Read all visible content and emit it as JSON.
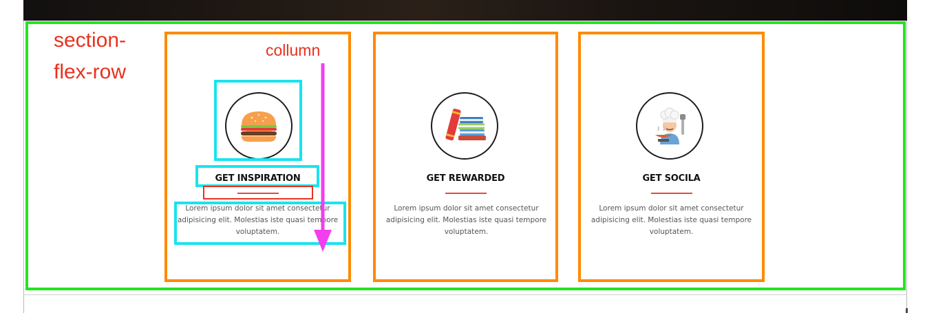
{
  "annotations": {
    "section_label": "section-flex-row",
    "column_label": "collumn",
    "colors": {
      "section_outline": "#22e51f",
      "column_outline": "#ff8a00",
      "element_outline": "#19e3ee",
      "divider_outline": "#e8311f",
      "arrow": "#f33df0",
      "label_text": "#e8311f"
    }
  },
  "cards": [
    {
      "icon": "hamburger-icon",
      "title": "GET INSPIRATION",
      "description": "Lorem ipsum dolor sit amet consectetur adipisicing elit. Molestias iste quasi tempore voluptatem."
    },
    {
      "icon": "books-icon",
      "title": "GET REWARDED",
      "description": "Lorem ipsum dolor sit amet consectetur adipisicing elit. Molestias iste quasi tempore voluptatem."
    },
    {
      "icon": "chef-icon",
      "title": "GET SOCILA",
      "description": "Lorem ipsum dolor sit amet consectetur adipisicing elit. Molestias iste quasi tempore voluptatem."
    }
  ],
  "theme": {
    "divider_color": "#e44a3c",
    "title_color": "#111111",
    "text_color": "#555555"
  }
}
